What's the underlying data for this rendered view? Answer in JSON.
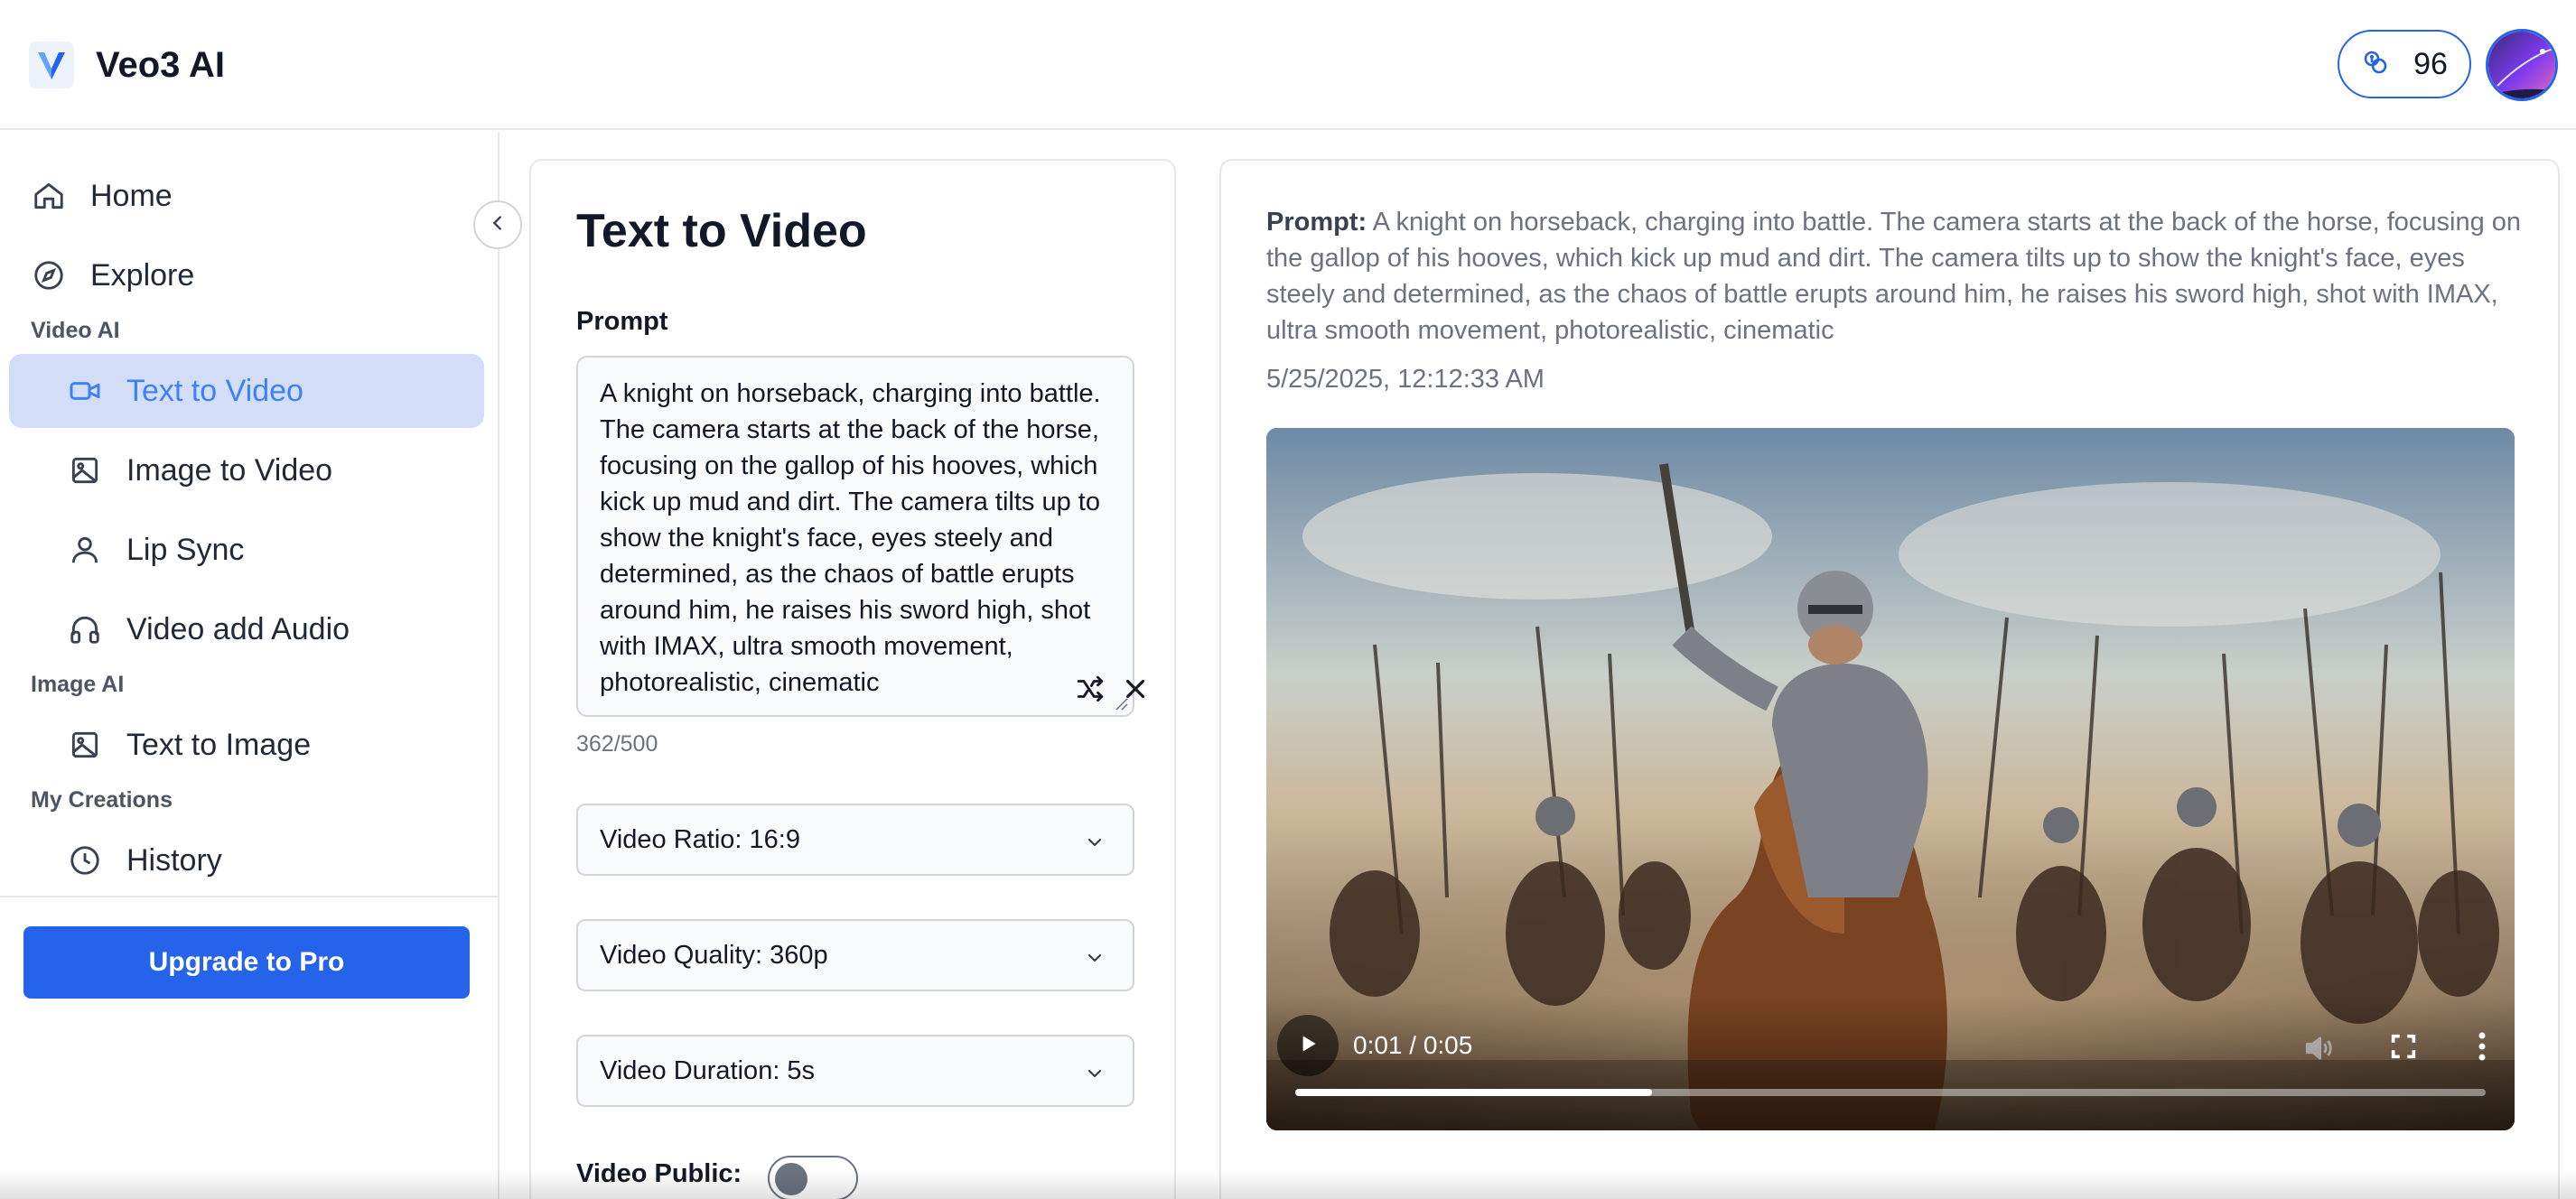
{
  "header": {
    "logo_letter": "V",
    "app_title": "Veo3 AI",
    "credits": "96",
    "credits_icon": "coins-icon",
    "accent_color": "#2563eb"
  },
  "sidebar": {
    "top_items": [
      {
        "label": "Home",
        "icon": "home-icon"
      },
      {
        "label": "Explore",
        "icon": "compass-icon"
      }
    ],
    "sections": [
      {
        "label": "Video AI",
        "items": [
          {
            "label": "Text to Video",
            "icon": "video-camera-icon",
            "active": true
          },
          {
            "label": "Image to Video",
            "icon": "image-icon"
          },
          {
            "label": "Lip Sync",
            "icon": "user-icon"
          },
          {
            "label": "Video add Audio",
            "icon": "headphones-icon"
          }
        ]
      },
      {
        "label": "Image AI",
        "items": [
          {
            "label": "Text to Image",
            "icon": "image-icon"
          }
        ]
      },
      {
        "label": "My Creations",
        "items": [
          {
            "label": "History",
            "icon": "clock-icon"
          }
        ]
      }
    ],
    "upgrade_label": "Upgrade to Pro"
  },
  "form": {
    "title": "Text to Video",
    "prompt_label": "Prompt",
    "prompt_value": "A knight on horseback, charging into battle. The camera starts at the back of the horse, focusing on the gallop of his hooves, which kick up mud and dirt. The camera tilts up to show the knight's face, eyes steely and determined, as the chaos of battle erupts around him, he raises his sword high, shot with IMAX, ultra smooth movement, photorealistic, cinematic",
    "char_count": "362/500",
    "selects": [
      {
        "label": "Video Ratio: 16:9"
      },
      {
        "label": "Video Quality: 360p"
      },
      {
        "label": "Video Duration: 5s"
      }
    ],
    "public_label": "Video Public:",
    "public_enabled": false
  },
  "result": {
    "prompt_label": "Prompt:",
    "prompt_text": "A knight on horseback, charging into battle. The camera starts at the back of the horse, focusing on the gallop of his hooves, which kick up mud and dirt. The camera tilts up to show the knight's face, eyes steely and determined, as the chaos of battle erupts around him, he raises his sword high, shot with IMAX, ultra smooth movement, photorealistic, cinematic",
    "date": "5/25/2025, 12:12:33 AM",
    "player": {
      "time": "0:01 / 0:05",
      "progress_fraction": 0.3
    }
  }
}
